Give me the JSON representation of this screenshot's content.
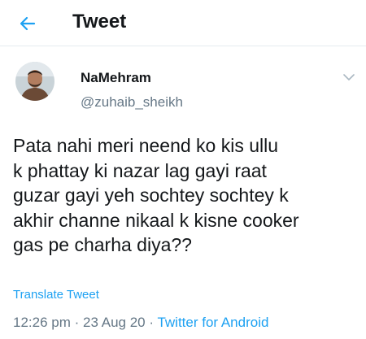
{
  "header": {
    "back_icon": "arrow-left-icon",
    "title": "Tweet"
  },
  "author": {
    "name": "NaMehram",
    "handle": "@zuhaib_sheikh",
    "more_icon": "chevron-down-icon"
  },
  "tweet": {
    "text": "Pata nahi meri neend ko kis ullu\nk phattay ki nazar lag gayi raat\nguzar gayi yeh sochtey sochtey k\nakhir channe nikaal k kisne cooker\ngas pe charha diya??",
    "translate_label": "Translate Tweet"
  },
  "meta": {
    "time": "12:26 pm",
    "separator": "·",
    "date": "23 Aug 20",
    "source": "Twitter for Android"
  },
  "colors": {
    "accent": "#1da1f2",
    "text": "#14171a",
    "secondary": "#657786"
  }
}
